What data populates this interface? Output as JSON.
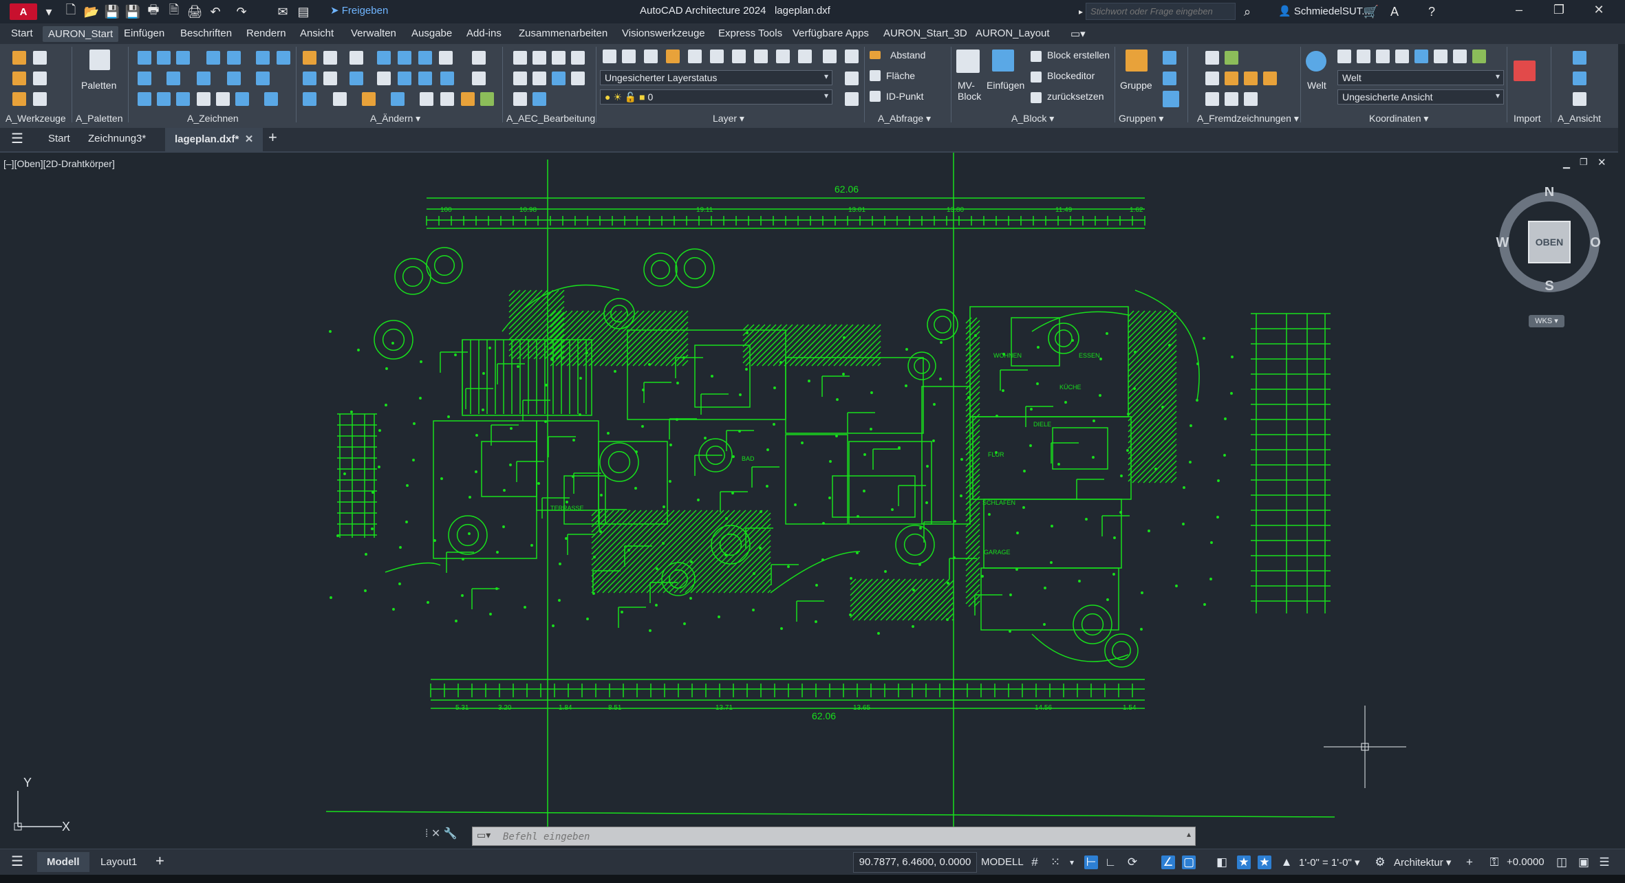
{
  "titlebar": {
    "logo_label": "A",
    "share_label": "Freigeben",
    "app_title": "AutoCAD Architecture 2024",
    "file_title": "lageplan.dxf",
    "search_placeholder": "Stichwort oder Frage eingeben",
    "user_name": "SchmiedelSUT...",
    "controls": [
      "–",
      "❐",
      "✕"
    ]
  },
  "menu": {
    "tabs": [
      "Start",
      "AURON_Start",
      "Einfügen",
      "Beschriften",
      "Rendern",
      "Ansicht",
      "Verwalten",
      "Ausgabe",
      "Add-ins",
      "Zusammenarbeiten",
      "Visionswerkzeuge",
      "Express Tools",
      "Verfügbare Apps",
      "AURON_Start_3D",
      "AURON_Layout"
    ],
    "active_tab": "AURON_Start"
  },
  "ribbon": {
    "panels": [
      "A_Werkzeuge",
      "A_Paletten",
      "A_Zeichnen",
      "A_Ändern ▾",
      "A_AEC_Bearbeitung",
      "Layer ▾",
      "A_Abfrage ▾",
      "A_Block ▾",
      "Gruppen ▾",
      "A_Fremdzeichnungen ▾",
      "Koordinaten ▾",
      "Import",
      "A_Ansicht"
    ],
    "paletten_label": "Paletten",
    "layer_state": "Ungesicherter Layerstatus",
    "layer_current": "0",
    "abfrage": [
      "Abstand",
      "Fläche",
      "ID-Punkt"
    ],
    "mv_block_label": "MV-\nBlock",
    "einfuegen_label": "Einfügen",
    "block_actions": [
      "Block erstellen",
      "Blockeditor",
      "zurücksetzen"
    ],
    "gruppe_label": "Gruppe",
    "welt_label": "Welt",
    "ucs_value": "Welt",
    "view_value": "Ungesicherte Ansicht"
  },
  "filetabs": {
    "tabs": [
      "Start",
      "Zeichnung3*",
      "lageplan.dxf*"
    ],
    "active": "lageplan.dxf*"
  },
  "viewport": {
    "label": "[–][Oben][2D-Drahtkörper]",
    "cube_face": "OBEN",
    "compass": {
      "n": "N",
      "s": "S",
      "e": "O",
      "w": "W"
    },
    "wcs_label": "WKS",
    "ucs_y": "Y",
    "ucs_x": "X",
    "dim_top": "62.06",
    "dim_bottom": "62.06",
    "sub_dims_top": [
      "100",
      "10.98",
      "19.11",
      "13.01",
      "13.80",
      "11.49",
      "1.62"
    ],
    "sub_dims_bottom": [
      "5.31",
      "3.20",
      "1.84",
      "8.51",
      "13.71",
      "13.65",
      "14.56",
      "1.54"
    ],
    "room_labels": [
      "WOHNEN",
      "ESSEN",
      "KÜCHE",
      "DIELE",
      "FLUR",
      "SCHLAFEN",
      "BAD",
      "GARAGE",
      "TERRASSE"
    ],
    "colors": {
      "line": "#18e01c",
      "background": "#212830"
    }
  },
  "commandline": {
    "placeholder": "Befehl eingeben"
  },
  "statusbar": {
    "tabs": [
      "Modell",
      "Layout1"
    ],
    "active": "Modell",
    "coords": "90.7877, 6.4600, 0.0000",
    "mode": "MODELL",
    "scale": "1'-0\" = 1'-0\"",
    "workspace": "Architektur",
    "elevation": "+0.0000"
  }
}
